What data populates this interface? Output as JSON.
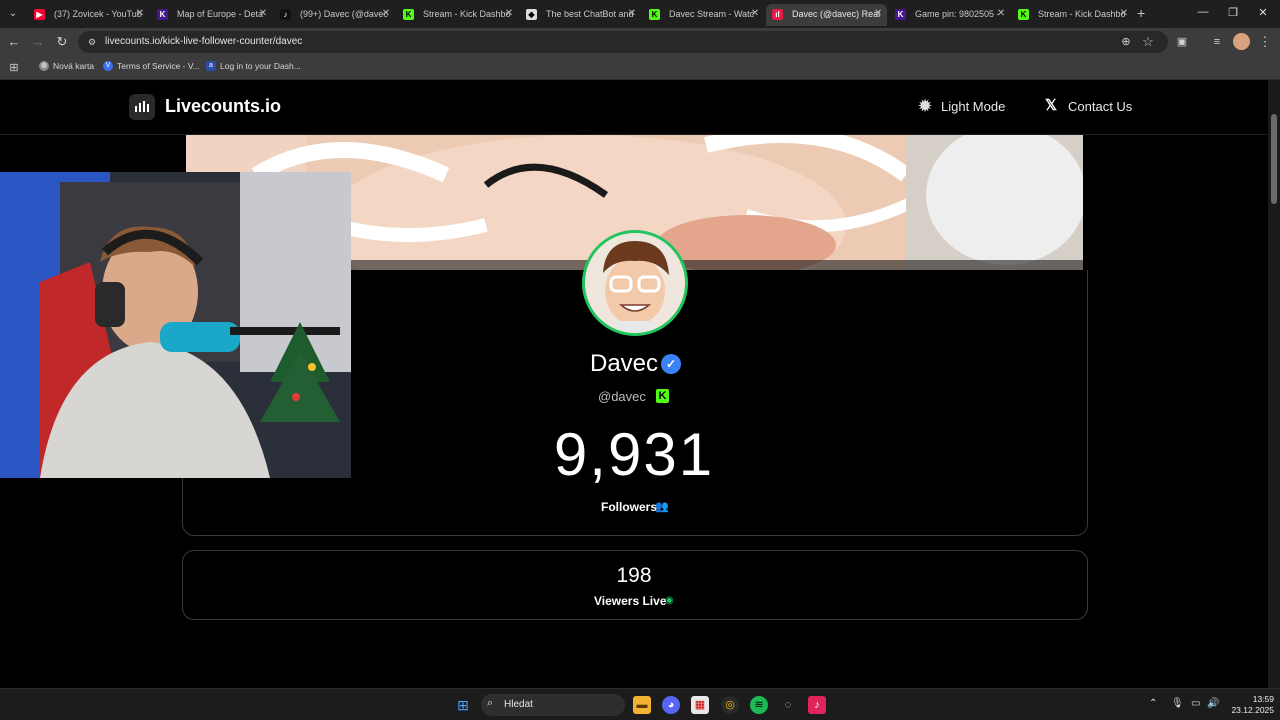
{
  "browser": {
    "tabs": [
      {
        "title": "(37) Zovicek - YouTub",
        "favicon": "youtube-icon",
        "color": "#ff0033"
      },
      {
        "title": "Map of Europe - Deta",
        "favicon": "kahoot-icon",
        "color": "#46178f"
      },
      {
        "title": "(99+) Davec (@davec",
        "favicon": "tiktok-icon",
        "color": "#111111"
      },
      {
        "title": "Stream - Kick Dashbo",
        "favicon": "kick-icon",
        "color": "#53fc18"
      },
      {
        "title": "The best ChatBot and",
        "favicon": "chatbot-icon",
        "color": "#dddddd"
      },
      {
        "title": "Davec Stream - Watc",
        "favicon": "kick-icon",
        "color": "#53fc18"
      },
      {
        "title": "Davec (@davec) Real",
        "favicon": "livecounts-icon",
        "color": "#e11d48",
        "active": true
      },
      {
        "title": "Game pin: 9802505 -",
        "favicon": "kahoot-icon",
        "color": "#46178f"
      },
      {
        "title": "Stream - Kick Dashbo",
        "favicon": "kick-icon",
        "color": "#53fc18"
      }
    ],
    "url": "livecounts.io/kick-live-follower-counter/davec",
    "bookmarks": [
      {
        "label": "Nová karta",
        "icon": "globe-icon"
      },
      {
        "label": "Terms of Service - V...",
        "icon": "v-icon"
      },
      {
        "label": "Log in to your Dash...",
        "icon": "a-icon"
      }
    ]
  },
  "site": {
    "logo_text": "Livecounts.io",
    "light_mode_label": "Light Mode",
    "contact_label": "Contact Us"
  },
  "profile": {
    "name": "Davec",
    "handle": "@davec",
    "followers_count": "9,931",
    "followers_label": "Followers",
    "viewers_count": "198",
    "viewers_label": "Viewers Live"
  },
  "colors": {
    "accent_green": "#22c55e",
    "kick_green": "#53fc18",
    "verified_blue": "#3b82f6"
  },
  "taskbar": {
    "search_placeholder": "Hledat",
    "time": "13:59",
    "date": "23.12.2025"
  }
}
